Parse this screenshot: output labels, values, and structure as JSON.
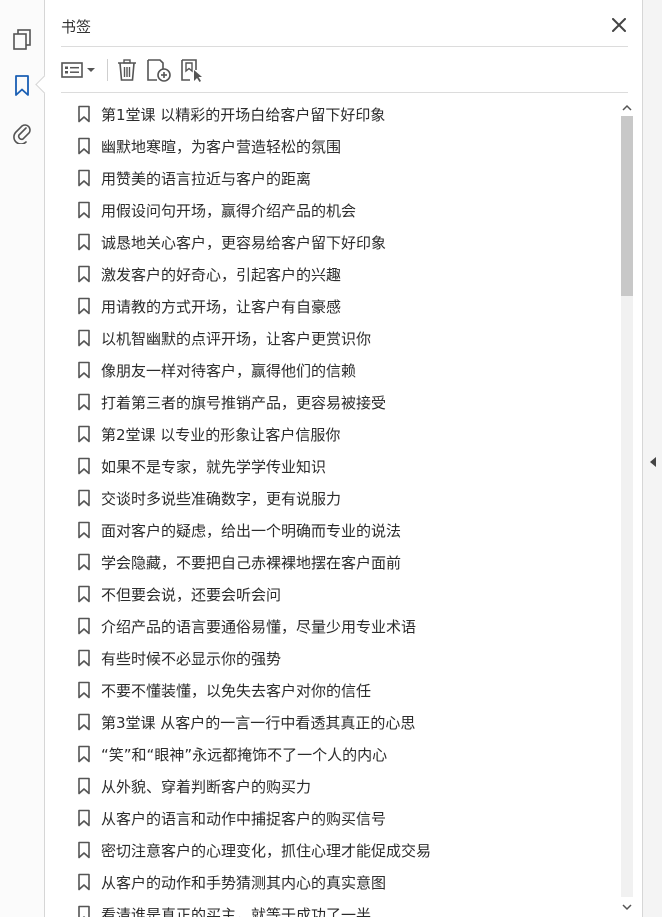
{
  "left_rail": {
    "items": [
      {
        "icon": "pages-icon"
      },
      {
        "icon": "bookmark-icon",
        "active": true
      },
      {
        "icon": "paperclip-icon"
      }
    ]
  },
  "panel": {
    "title": "书签",
    "toolbar": {
      "options": "list-options-icon",
      "delete": "trash-icon",
      "new_bookmark": "new-bookmark-icon",
      "find_bookmark": "find-bookmark-icon"
    }
  },
  "bookmarks": [
    "第1堂课 以精彩的开场白给客户留下好印象",
    "幽默地寒暄，为客户营造轻松的氛围",
    "用赞美的语言拉近与客户的距离",
    "用假设问句开场，赢得介绍产品的机会",
    "诚恳地关心客户，更容易给客户留下好印象",
    "激发客户的好奇心，引起客户的兴趣",
    "用请教的方式开场，让客户有自豪感",
    "以机智幽默的点评开场，让客户更赏识你",
    "像朋友一样对待客户，赢得他们的信赖",
    "打着第三者的旗号推销产品，更容易被接受",
    "第2堂课 以专业的形象让客户信服你",
    "如果不是专家，就先学学传业知识",
    "交谈时多说些准确数字，更有说服力",
    "面对客户的疑虑，给出一个明确而专业的说法",
    "学会隐藏，不要把自己赤裸裸地摆在客户面前",
    "不但要会说，还要会听会问",
    "介绍产品的语言要通俗易懂，尽量少用专业术语",
    "有些时候不必显示你的强势",
    "不要不懂装懂，以免失去客户对你的信任",
    "第3堂课 从客户的一言一行中看透其真正的心思",
    "“笑”和“眼神”永远都掩饰不了一个人的内心",
    "从外貌、穿着判断客户的购买力",
    "从客户的语言和动作中捕捉客户的购买信号",
    "密切注意客户的心理变化，抓住心理才能促成交易",
    "从客户的动作和手势猜测其内心的真实意图",
    "看清谁是真正的买主，就等于成功了一半"
  ],
  "colors": {
    "accent": "#1a5fb4",
    "icon": "#555555"
  }
}
